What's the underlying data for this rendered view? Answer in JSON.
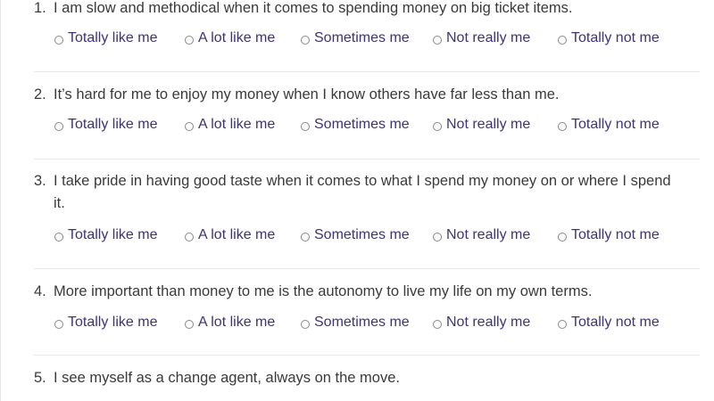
{
  "options": [
    "Totally like me",
    "A lot like me",
    "Sometimes me",
    "Not really me",
    "Totally not me"
  ],
  "questions": [
    {
      "number": "1.",
      "text": "I am slow and methodical when it comes to spending money on big ticket items."
    },
    {
      "number": "2.",
      "text": "It’s hard for me to enjoy my money when I know others have far less than me."
    },
    {
      "number": "3.",
      "text": "I take pride in having good taste when it comes to what I spend my money on or where I spend it."
    },
    {
      "number": "4.",
      "text": "More important than money to me is the autonomy to live my life on my own terms."
    },
    {
      "number": "5.",
      "text": "I see myself as a change agent, always on the move."
    }
  ]
}
